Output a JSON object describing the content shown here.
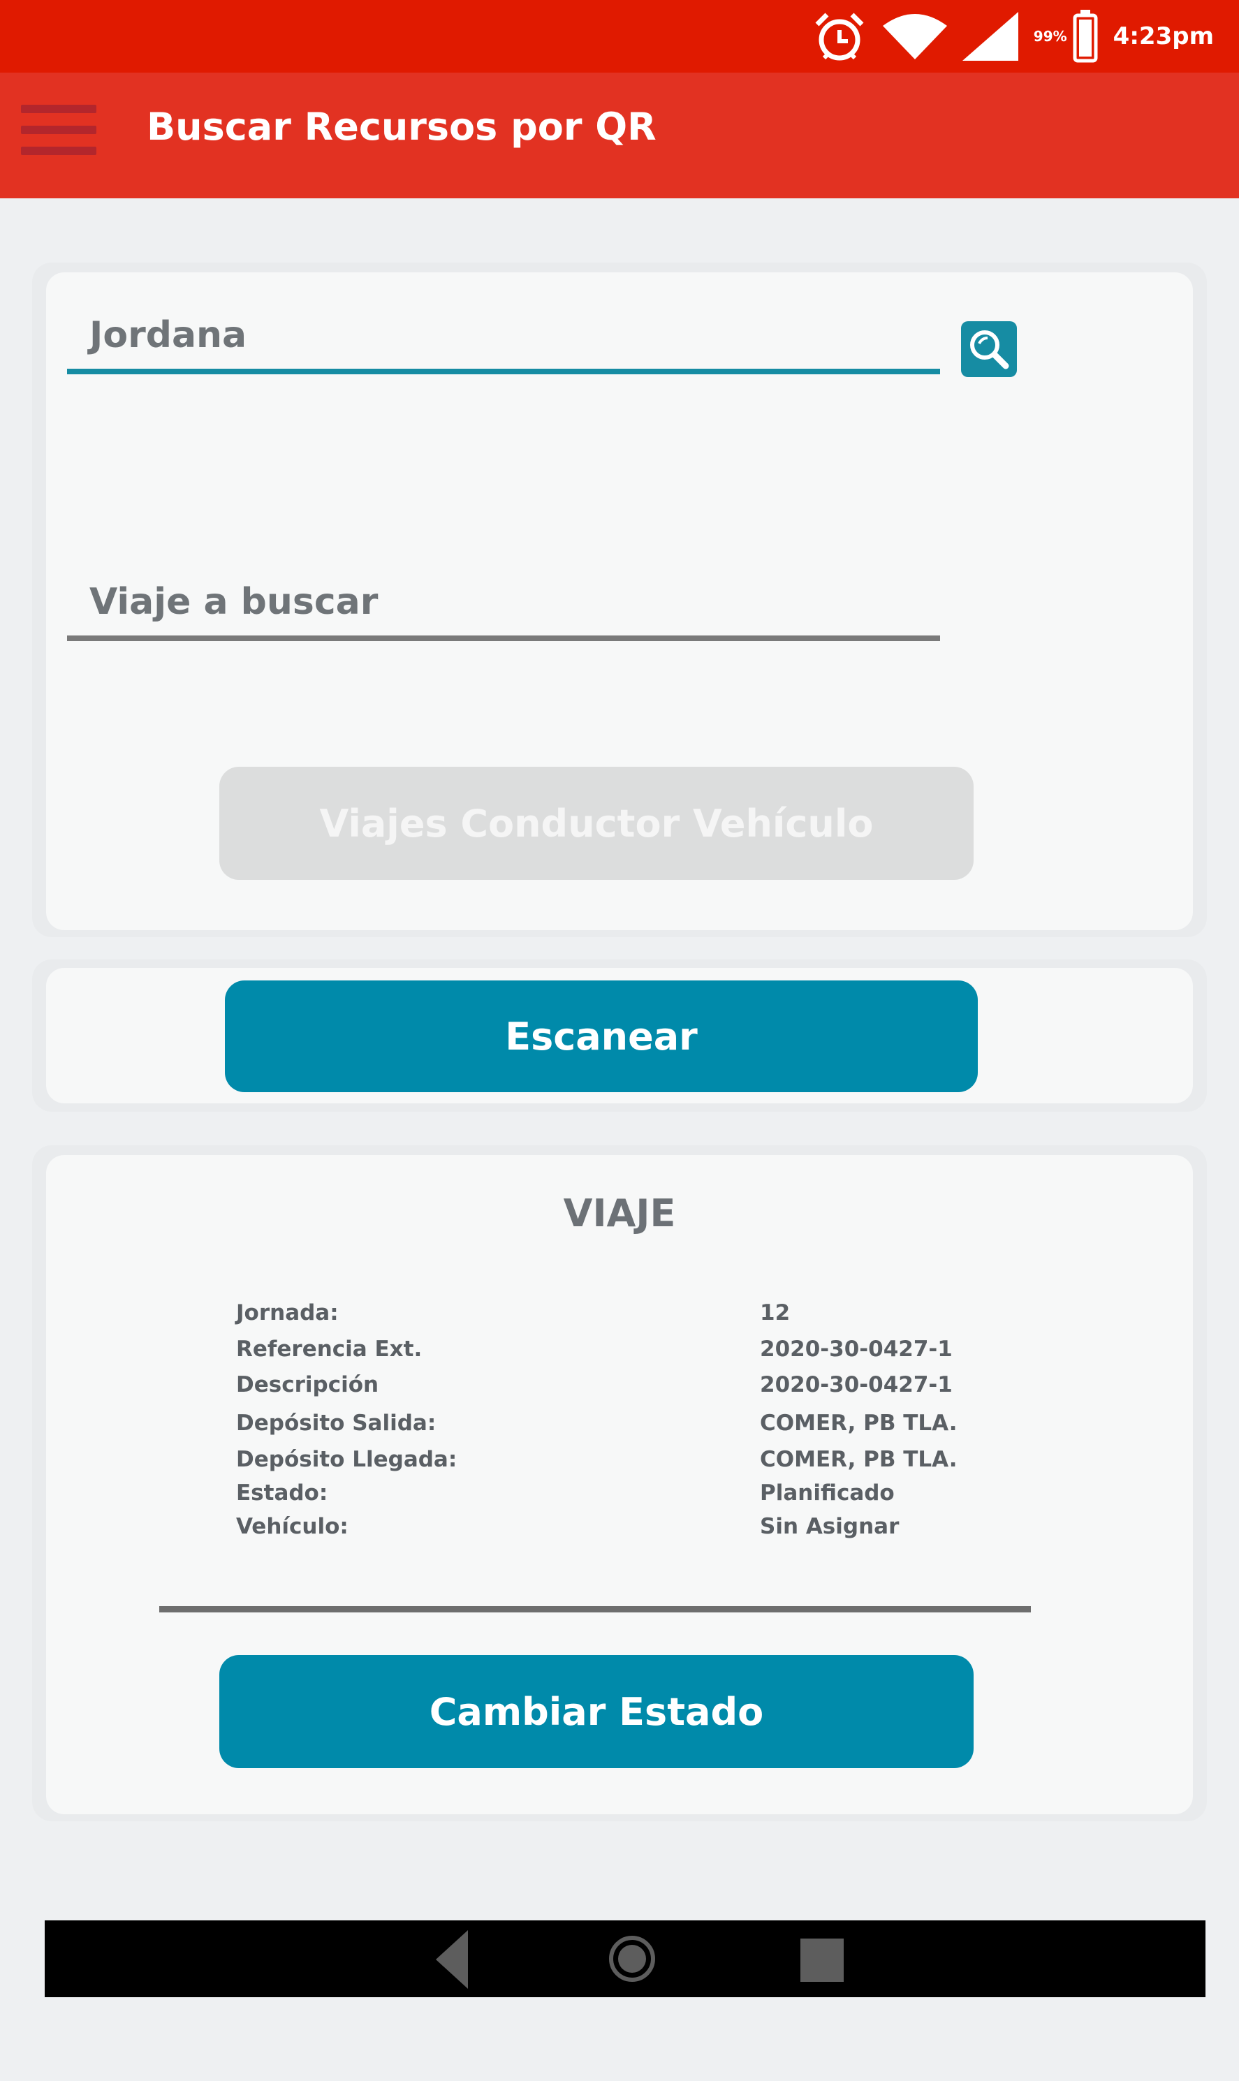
{
  "status_bar": {
    "battery_pct": "99%",
    "time": "4:23pm",
    "icons": [
      "alarm-icon",
      "wifi-icon",
      "signal-icon",
      "battery-icon"
    ]
  },
  "app_bar": {
    "title": "Buscar Recursos por QR",
    "menu_icon": "hamburger-menu-icon"
  },
  "search_card": {
    "driver_field": {
      "value": "Jordana",
      "line_color": "#168ca3"
    },
    "search_icon": "magnifier-icon",
    "trip_field": {
      "placeholder": "Viaje a buscar",
      "line_color": "#7a7a7a"
    },
    "trips_button_label": "Viajes Conductor Vehículo"
  },
  "scan_card": {
    "scan_button_label": "Escanear"
  },
  "trip_card": {
    "title": "VIAJE",
    "details": [
      {
        "label": "Jornada:",
        "value": "12"
      },
      {
        "label": "Referencia Ext.",
        "value": "2020-30-0427-1"
      },
      {
        "label": "Descripción",
        "value": "2020-30-0427-1"
      },
      {
        "label": "Depósito Salida:",
        "value": "COMER, PB TLA."
      },
      {
        "label": "Depósito Llegada:",
        "value": "COMER, PB TLA."
      },
      {
        "label": "Estado:",
        "value": "Planificado"
      },
      {
        "label": "Vehículo:",
        "value": "Sin Asignar"
      }
    ],
    "change_state_button_label": "Cambiar Estado"
  },
  "colors": {
    "status_bar": "#e01a00",
    "app_bar": "#e23222",
    "primary": "#008aaa",
    "disabled": "#dcdddd"
  },
  "nav_bar": {
    "icons": [
      "back-icon",
      "home-icon",
      "recents-icon"
    ]
  }
}
